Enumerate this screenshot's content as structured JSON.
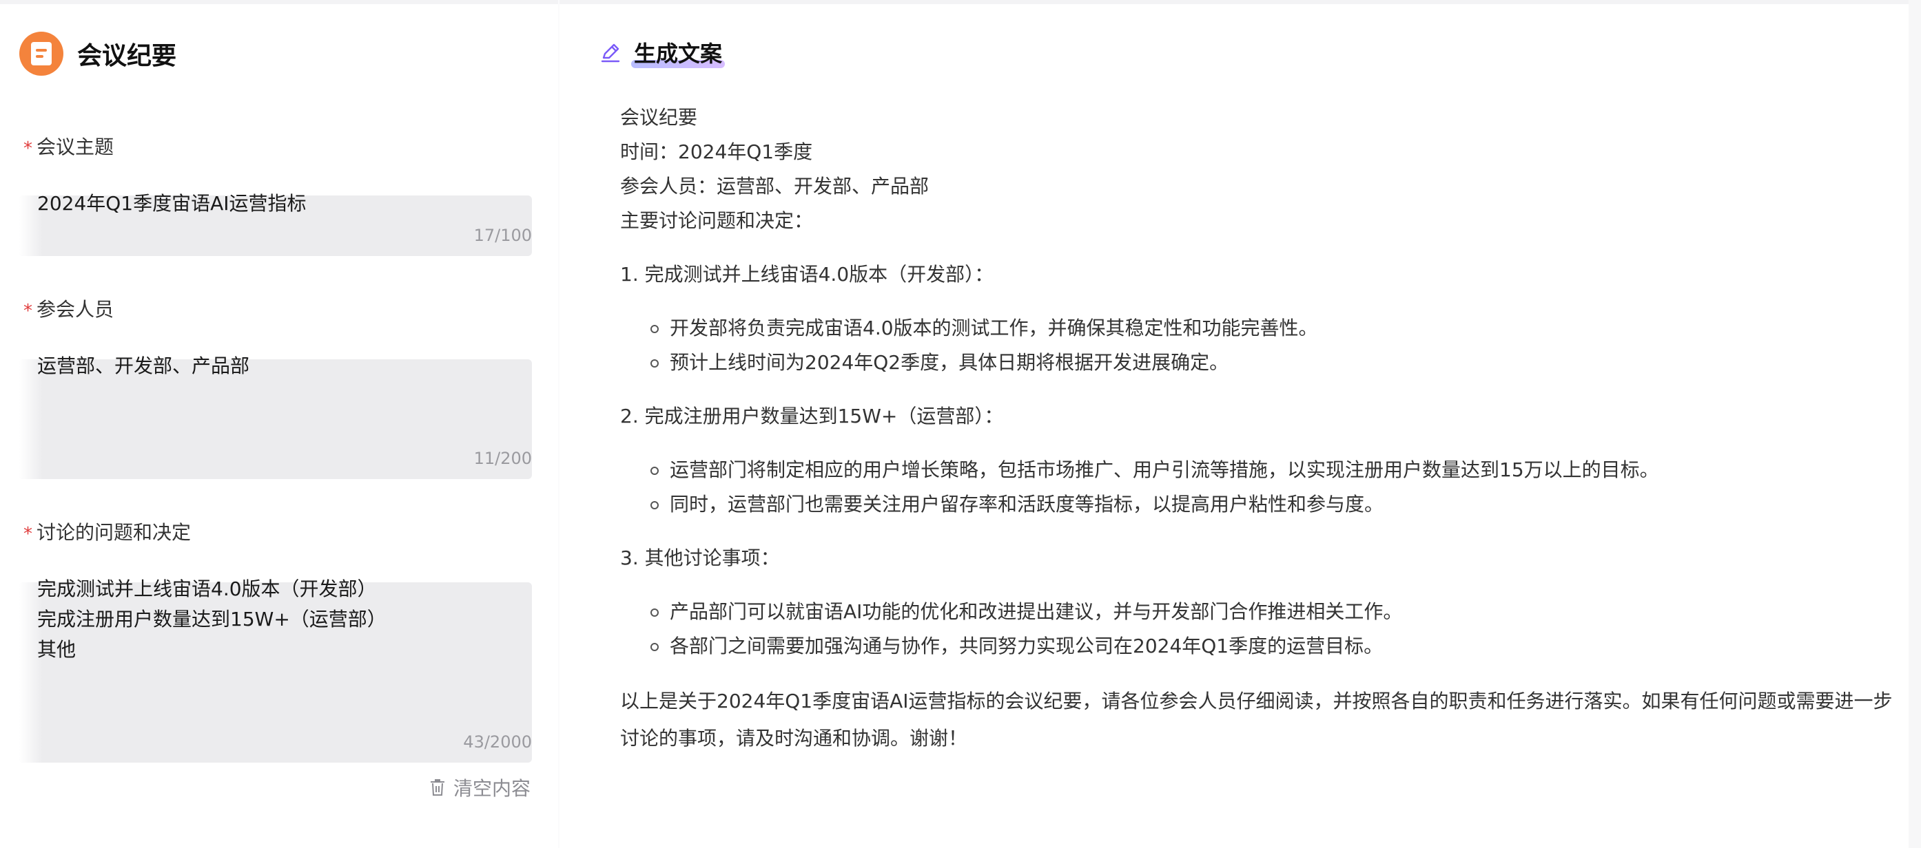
{
  "app": {
    "title": "会议纪要",
    "logo_icon": "document-icon",
    "accent_color": "#f4833c"
  },
  "form": {
    "topic": {
      "label": "会议主题",
      "required_mark": "*",
      "value": "2024年Q1季度宙语AI运营指标",
      "count": "17/100"
    },
    "attendees": {
      "label": "参会人员",
      "required_mark": "*",
      "value": "运营部、开发部、产品部",
      "count": "11/200"
    },
    "issues": {
      "label": "讨论的问题和决定",
      "required_mark": "*",
      "value": "完成测试并上线宙语4.0版本（开发部）\n完成注册用户数量达到15W+（运营部）\n其他",
      "count": "43/2000"
    },
    "clear_label": "清空内容"
  },
  "output": {
    "header_title": "生成文案",
    "header_icon": "pen-icon",
    "lines": [
      "会议纪要",
      "时间：2024年Q1季度",
      "参会人员：运营部、开发部、产品部",
      "主要讨论问题和决定："
    ],
    "sections": [
      {
        "heading": "1. 完成测试并上线宙语4.0版本（开发部）：",
        "bullets": [
          "开发部将负责完成宙语4.0版本的测试工作，并确保其稳定性和功能完善性。",
          "预计上线时间为2024年Q2季度，具体日期将根据开发进展确定。"
        ]
      },
      {
        "heading": "2. 完成注册用户数量达到15W+（运营部）：",
        "bullets": [
          "运营部门将制定相应的用户增长策略，包括市场推广、用户引流等措施，以实现注册用户数量达到15万以上的目标。",
          "同时，运营部门也需要关注用户留存率和活跃度等指标，以提高用户粘性和参与度。"
        ]
      },
      {
        "heading": "3. 其他讨论事项：",
        "bullets": [
          "产品部门可以就宙语AI功能的优化和改进提出建议，并与开发部门合作推进相关工作。",
          "各部门之间需要加强沟通与协作，共同努力实现公司在2024年Q1季度的运营目标。"
        ]
      }
    ],
    "closing": "以上是关于2024年Q1季度宙语AI运营指标的会议纪要，请各位参会人员仔细阅读，并按照各自的职责和任务进行落实。如果有任何问题或需要进一步讨论的事项，请及时沟通和协调。谢谢！"
  }
}
